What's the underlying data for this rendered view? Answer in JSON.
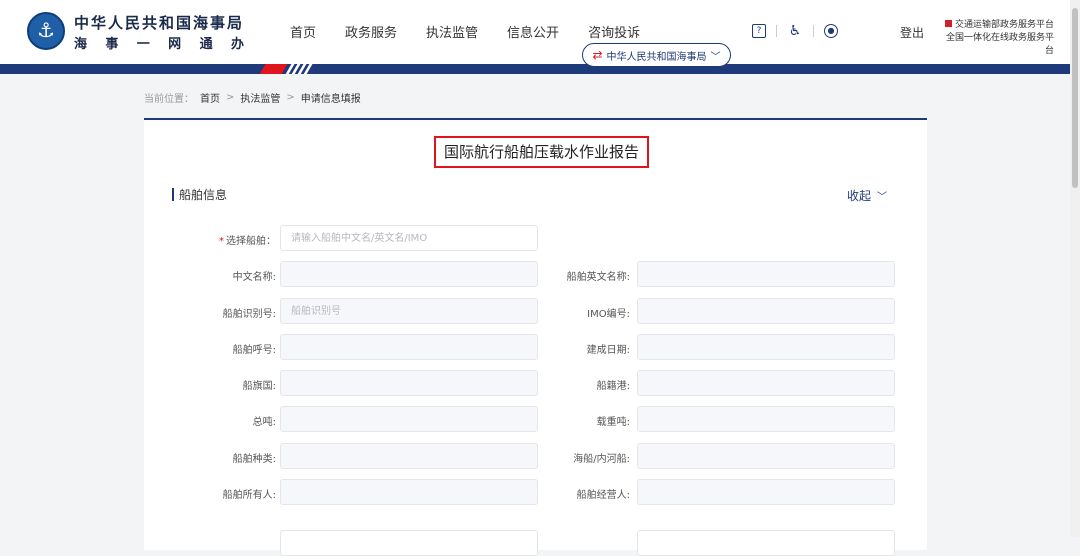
{
  "header": {
    "logo_title": "中华人民共和国海事局",
    "logo_sub": [
      "海",
      "事",
      "一",
      "网",
      "通",
      "办"
    ],
    "nav": [
      "首页",
      "政务服务",
      "执法监管",
      "信息公开",
      "咨询投诉"
    ],
    "org_dropdown": "中华人民共和国海事局",
    "login": "登出",
    "platform_line1": "交通运输部政务服务平台",
    "platform_line2": "全国一体化在线政务服务平台"
  },
  "breadcrumb": {
    "prefix": "当前位置：",
    "items": [
      "首页",
      "执法监管",
      "申请信息填报"
    ]
  },
  "form": {
    "title": "国际航行船舶压载水作业报告",
    "section": "船舶信息",
    "collapse": "收起",
    "select_ship": {
      "required_mark": "*",
      "label": "选择船舶：",
      "placeholder": "请输入船舶中文名/英文名/IMO",
      "value": ""
    },
    "fields": [
      {
        "label": "中文名称:",
        "placeholder": "",
        "value": ""
      },
      {
        "label": "船舶英文名称:",
        "placeholder": "",
        "value": ""
      },
      {
        "label": "船舶识别号:",
        "placeholder": "船舶识别号",
        "value": ""
      },
      {
        "label": "IMO编号:",
        "placeholder": "",
        "value": ""
      },
      {
        "label": "船舶呼号:",
        "placeholder": "",
        "value": ""
      },
      {
        "label": "建成日期:",
        "placeholder": "",
        "value": ""
      },
      {
        "label": "船旗国:",
        "placeholder": "",
        "value": ""
      },
      {
        "label": "船籍港:",
        "placeholder": "",
        "value": ""
      },
      {
        "label": "总吨:",
        "placeholder": "",
        "value": ""
      },
      {
        "label": "载重吨:",
        "placeholder": "",
        "value": ""
      },
      {
        "label": "船舶种类:",
        "placeholder": "",
        "value": ""
      },
      {
        "label": "海船/内河船:",
        "placeholder": "",
        "value": ""
      },
      {
        "label": "船舶所有人:",
        "placeholder": "",
        "value": ""
      },
      {
        "label": "船舶经营人:",
        "placeholder": "",
        "value": ""
      }
    ]
  },
  "colors": {
    "brand_blue": "#1f3a7a",
    "accent_red": "#e0141c"
  },
  "icons": [
    "help-icon",
    "accessibility-icon",
    "user-icon",
    "swap-icon",
    "chevron-down-icon"
  ]
}
